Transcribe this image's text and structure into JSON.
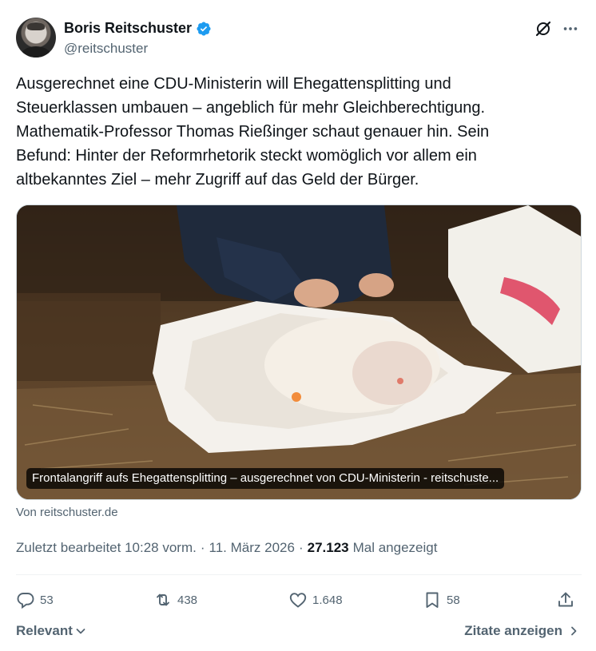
{
  "author": {
    "display_name": "Boris Reitschuster",
    "handle": "@reitschuster",
    "verified": true
  },
  "tweet": {
    "text": "Ausgerechnet eine CDU-Ministerin will Ehegattensplitting und\nSteuerklassen umbauen – angeblich für mehr Gleichberechtigung.\nMathematik-Professor Thomas Rießinger schaut genauer hin. Sein\nBefund: Hinter der Reformrhetorik steckt womöglich vor allem ein\naltbekanntes Ziel – mehr Zugriff auf das Geld der Bürger."
  },
  "card": {
    "caption": "Frontalangriff aufs Ehegattensplitting – ausgerechnet von CDU-Ministerin - reitschuste...",
    "source": "Von reitschuster.de"
  },
  "meta": {
    "edited": "Zuletzt bearbeitet 10:28 vorm.",
    "separator1": "·",
    "date": "11. März 2026",
    "separator2": "·",
    "views_count": "27.123",
    "views_label": "Mal angezeigt"
  },
  "actions": {
    "replies": "53",
    "reposts": "438",
    "likes": "1.648",
    "bookmarks": "58"
  },
  "footer": {
    "sort_label": "Relevant",
    "quotes_label": "Zitate anzeigen"
  },
  "colors": {
    "text_primary": "#0f1419",
    "text_secondary": "#536471",
    "verified_blue": "#1d9bf0",
    "divider": "#eff3f4"
  },
  "icons": [
    "verified-badge-icon",
    "grok-icon",
    "more-icon",
    "reply-icon",
    "repost-icon",
    "like-icon",
    "bookmark-icon",
    "share-icon",
    "chevron-down-icon",
    "chevron-right-icon"
  ]
}
